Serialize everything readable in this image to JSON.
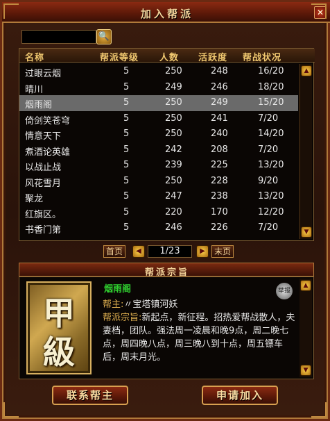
{
  "window": {
    "title": "加入帮派",
    "close_glyph": "✕"
  },
  "search": {
    "value": "",
    "button_glyph": "🔍"
  },
  "table": {
    "headers": [
      "名称",
      "帮派等级",
      "人数",
      "活跃度",
      "帮战状况"
    ],
    "rows": [
      {
        "name": "过眼云烟",
        "level": "5",
        "count": "250",
        "active": "248",
        "war": "16/20"
      },
      {
        "name": "晴川",
        "level": "5",
        "count": "249",
        "active": "246",
        "war": "18/20"
      },
      {
        "name": "烟雨阁",
        "level": "5",
        "count": "250",
        "active": "249",
        "war": "15/20"
      },
      {
        "name": "倚剑笑苍穹",
        "level": "5",
        "count": "250",
        "active": "241",
        "war": "7/20"
      },
      {
        "name": "情意天下",
        "level": "5",
        "count": "250",
        "active": "240",
        "war": "14/20"
      },
      {
        "name": "煮酒论英雄",
        "level": "5",
        "count": "242",
        "active": "208",
        "war": "7/20"
      },
      {
        "name": "以战止战",
        "level": "5",
        "count": "239",
        "active": "225",
        "war": "13/20"
      },
      {
        "name": "风花雪月",
        "level": "5",
        "count": "250",
        "active": "228",
        "war": "9/20"
      },
      {
        "name": "聚龙",
        "level": "5",
        "count": "247",
        "active": "238",
        "war": "13/20"
      },
      {
        "name": "红旗区。",
        "level": "5",
        "count": "220",
        "active": "170",
        "war": "12/20"
      },
      {
        "name": "书香门第",
        "level": "5",
        "count": "246",
        "active": "226",
        "war": "7/20"
      }
    ],
    "selected_index": 2
  },
  "pager": {
    "first_label": "首页",
    "last_label": "末页",
    "page_text": "1/23"
  },
  "detail": {
    "section_title": "帮派宗旨",
    "emblem_char_1": "甲",
    "emblem_char_2": "級",
    "guild_name": "烟雨阁",
    "report_label": "举报",
    "leader_label": "帮主:",
    "leader_value": "〃宝塔镇河妖",
    "purpose_label": "帮派宗旨:",
    "purpose_value": "新起点，新征程。招热爱帮战散人，夫妻档，团队。强法周一凌晨和晚9点，周二晚七点，周四晚八点，周三晚八到十点，周五镖车后，周末月光。"
  },
  "buttons": {
    "contact_leader": "联系帮主",
    "apply_join": "申请加入"
  },
  "colors": {
    "accent": "#f0c870",
    "guild_name": "#30d030",
    "selected_row": "#6a6a6a"
  }
}
